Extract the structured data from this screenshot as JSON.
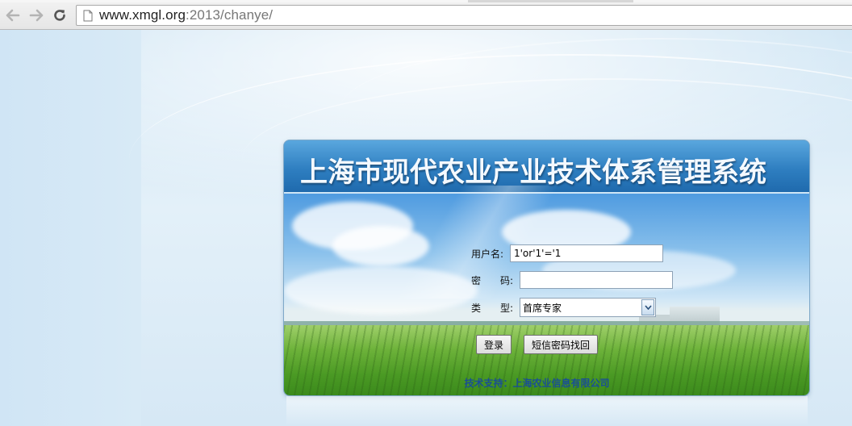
{
  "browser": {
    "url_host": "www.xmgl.org",
    "url_rest": ":2013/chanye/"
  },
  "panel": {
    "title": "上海市现代农业产业技术体系管理系统"
  },
  "form": {
    "username_label": "用户名:",
    "username_value": "1'or'1'='1",
    "password_label": "密　　码:",
    "password_value": "",
    "type_label": "类　　型:",
    "type_selected": "首席专家",
    "login_button": "登录",
    "sms_recover_button": "短信密码找回"
  },
  "footer": {
    "text": "技术支持：上海农业信息有限公司"
  },
  "colors": {
    "title_bar": "#2f7fc1",
    "footer_text": "#1a4f94"
  }
}
